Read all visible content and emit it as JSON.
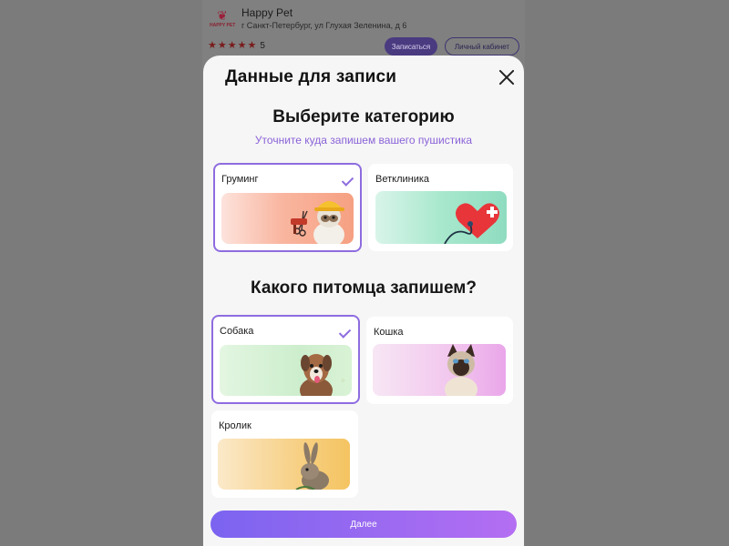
{
  "background": {
    "clinic_name": "Happy Pet",
    "logo_text": "HAPPY PET",
    "address": "г Санкт-Петербург, ул Глухая Зеленина, д 6",
    "rating_value": "5",
    "signup_button": "Записаться",
    "cabinet_button": "Личный кабинет"
  },
  "modal": {
    "title": "Данные для записи",
    "category_section": {
      "title": "Выберите категорию",
      "subtitle": "Уточните куда запишем вашего пушистика",
      "options": [
        {
          "label": "Груминг",
          "selected": true,
          "icon": "grooming-cat-image"
        },
        {
          "label": "Ветклиника",
          "selected": false,
          "icon": "vet-heart-image"
        }
      ]
    },
    "pet_section": {
      "title": "Какого питомца запишем?",
      "options": [
        {
          "label": "Собака",
          "selected": true,
          "icon": "dog-image"
        },
        {
          "label": "Кошка",
          "selected": false,
          "icon": "cat-image"
        },
        {
          "label": "Кролик",
          "selected": false,
          "icon": "rabbit-image"
        }
      ]
    },
    "next_button": "Далее"
  },
  "colors": {
    "accent": "#8e6ce0",
    "button_gradient_start": "#7b64f0",
    "button_gradient_end": "#b46ef2",
    "overlay": "#808080"
  }
}
